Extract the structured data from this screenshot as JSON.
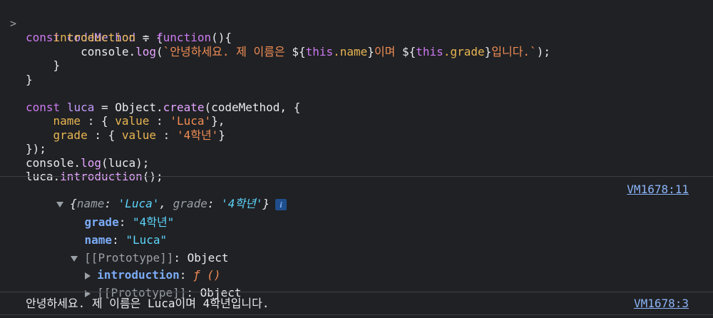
{
  "prompt_symbol": ">",
  "code": {
    "l1": {
      "kw": "const",
      "name": "codeMethod",
      "rest": " = {"
    },
    "l2": {
      "prop": "introduction",
      "sep": " : ",
      "kw": "function",
      "rest": "(){"
    },
    "l3": {
      "obj": "console.",
      "fn": "log",
      "open": "(",
      "t1": "`안녕하세요. 제 이름은 ",
      "d1": "${",
      "this1": "this",
      "p1": ".name",
      "c1": "}",
      "t2": "이며 ",
      "d2": "${",
      "this2": "this",
      "p2": ".grade",
      "c2": "}",
      "t3": "입니다.`",
      "close": ");"
    },
    "l4": "}",
    "l5": "}",
    "l7": {
      "kw": "const",
      "name": "luca",
      "mid": " = Object.",
      "fn": "create",
      "rest": "(codeMethod, {"
    },
    "l8": {
      "prop": "name",
      "a": " : { ",
      "vk": "value",
      "b": " : ",
      "str": "'Luca'",
      "c": "},"
    },
    "l9": {
      "prop": "grade",
      "a": " : { ",
      "vk": "value",
      "b": " : ",
      "str": "'4학년'",
      "c": "}"
    },
    "l10": "});",
    "l11": {
      "obj": "console.",
      "fn": "log",
      "rest": "(luca);"
    },
    "l12": {
      "obj": "luca.",
      "fn": "introduction",
      "rest": "();"
    }
  },
  "log1": {
    "summary": {
      "open": "{",
      "k1": "name",
      "col1": ": ",
      "v1": "'Luca'",
      "sep": ", ",
      "k2": "grade",
      "col2": ": ",
      "v2": "'4학년'",
      "close": "}"
    },
    "info_badge": "i",
    "source": "VM1678:11",
    "grade_key": "grade",
    "grade_val": "\"4학년\"",
    "name_key": "name",
    "name_val": "\"Luca\"",
    "proto_label": "[[Prototype]]",
    "proto_val": ": Object",
    "intro_key": "introduction",
    "intro_val": "ƒ ()",
    "proto2_label": "[[Prototype]]",
    "proto2_val": ": Object"
  },
  "log2": {
    "text": "안녕하세요. 제 이름은 Luca이며 4학년입니다.",
    "source": "VM1678:3"
  }
}
